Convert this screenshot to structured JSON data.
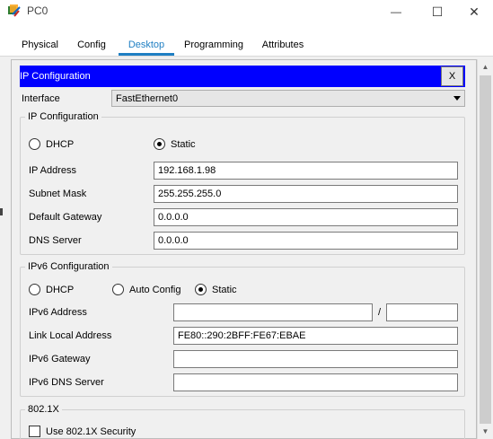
{
  "window": {
    "title": "PC0",
    "minimize_glyph": "—",
    "maximize_glyph": "☐",
    "close_glyph": "✕"
  },
  "tabs": [
    {
      "label": "Physical",
      "active": false
    },
    {
      "label": "Config",
      "active": false
    },
    {
      "label": "Desktop",
      "active": true
    },
    {
      "label": "Programming",
      "active": false
    },
    {
      "label": "Attributes",
      "active": false
    }
  ],
  "panel": {
    "title": "IP Configuration",
    "close_label": "X"
  },
  "interface": {
    "label": "Interface",
    "value": "FastEthernet0"
  },
  "ipv4": {
    "group_title": "IP Configuration",
    "dhcp_label": "DHCP",
    "static_label": "Static",
    "selected": "Static",
    "ip_address_label": "IP Address",
    "ip_address": "192.168.1.98",
    "subnet_mask_label": "Subnet Mask",
    "subnet_mask": "255.255.255.0",
    "gateway_label": "Default Gateway",
    "gateway": "0.0.0.0",
    "dns_label": "DNS Server",
    "dns": "0.0.0.0"
  },
  "ipv6": {
    "group_title": "IPv6 Configuration",
    "dhcp_label": "DHCP",
    "auto_label": "Auto Config",
    "static_label": "Static",
    "selected": "Static",
    "address_label": "IPv6 Address",
    "address": "",
    "prefix_separator": "/",
    "prefix": "",
    "link_local_label": "Link Local Address",
    "link_local": "FE80::290:2BFF:FE67:EBAE",
    "gateway_label": "IPv6 Gateway",
    "gateway": "",
    "dns_label": "IPv6 DNS Server",
    "dns": ""
  },
  "dot1x": {
    "group_title": "802.1X",
    "checkbox_label": "Use 802.1X Security",
    "checked": false
  },
  "colors": {
    "header_bg": "#0000ff",
    "tab_active": "#1f7fc3"
  }
}
